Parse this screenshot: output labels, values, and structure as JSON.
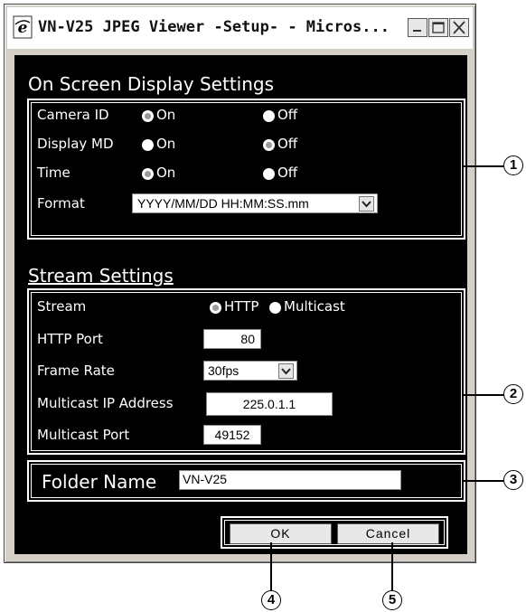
{
  "window": {
    "title": "VN-V25 JPEG Viewer -Setup- - Micros...",
    "icons": {
      "app": "ie-icon",
      "minimize": "minimize-icon",
      "maximize": "maximize-icon",
      "close": "close-icon"
    }
  },
  "osd": {
    "title": "On Screen Display Settings",
    "camera_id": {
      "label": "Camera ID",
      "on": "On",
      "off": "Off",
      "selected": "on"
    },
    "display_md": {
      "label": "Display MD",
      "on": "On",
      "off": "Off",
      "selected": "off"
    },
    "time": {
      "label": "Time",
      "on": "On",
      "off": "Off",
      "selected": "on"
    },
    "format": {
      "label": "Format",
      "value": "YYYY/MM/DD HH:MM:SS.mm"
    }
  },
  "stream": {
    "title": "Stream Settings",
    "stream": {
      "label": "Stream",
      "http": "HTTP",
      "multicast": "Multicast",
      "selected": "http"
    },
    "http_port": {
      "label": "HTTP Port",
      "value": "80"
    },
    "frame_rate": {
      "label": "Frame Rate",
      "value": "30fps"
    },
    "multicast_ip": {
      "label": "Multicast IP Address",
      "value": "225.0.1.1"
    },
    "multicast_port": {
      "label": "Multicast Port",
      "value": "49152"
    }
  },
  "folder": {
    "label": "Folder Name",
    "value": "VN-V25"
  },
  "buttons": {
    "ok": "OK",
    "cancel": "Cancel"
  },
  "callouts": [
    "1",
    "2",
    "3",
    "4",
    "5"
  ]
}
